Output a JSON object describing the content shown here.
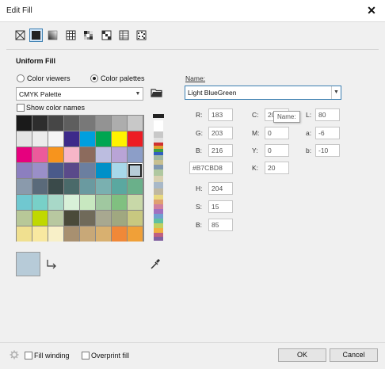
{
  "window": {
    "title": "Edit Fill",
    "close": "✕"
  },
  "fill_types": [
    {
      "name": "no-fill",
      "active": false
    },
    {
      "name": "uniform-fill",
      "active": true
    },
    {
      "name": "fountain-fill",
      "active": false
    },
    {
      "name": "vector-pattern",
      "active": false
    },
    {
      "name": "bitmap-pattern",
      "active": false
    },
    {
      "name": "two-color-pattern",
      "active": false
    },
    {
      "name": "texture-fill",
      "active": false
    }
  ],
  "uniform": {
    "heading": "Uniform Fill",
    "radio_viewers": "Color viewers",
    "radio_palettes": "Color palettes",
    "palette_value": "CMYK Palette",
    "show_names": "Show color names"
  },
  "palette_colors": [
    "#1a1a1a",
    "#2d2d2d",
    "#464646",
    "#5e5e5e",
    "#787878",
    "#939393",
    "#adadad",
    "#c8c8c8",
    "#e4e4e4",
    "#ececec",
    "#f5f5f5",
    "#3d2a8a",
    "#009fdf",
    "#00a651",
    "#fff200",
    "#ed1c24",
    "#e6007e",
    "#ec5a9b",
    "#f7941d",
    "#f7b6c8",
    "#8c6b5d",
    "#bcbde0",
    "#b9a4d6",
    "#8c9ec8",
    "#8c7fbf",
    "#9a8fc8",
    "#4a5a8a",
    "#5a4a8a",
    "#6b7fa0",
    "#0090c8",
    "#a8d8ea",
    "#b7cbd8",
    "#8a9aac",
    "#5a6a7a",
    "#3a4a4a",
    "#4a6a6a",
    "#6a9aa0",
    "#7ab0b0",
    "#5aa8a0",
    "#6ab08a",
    "#70c8d0",
    "#78d0c8",
    "#a8d8c8",
    "#d8f0d8",
    "#c8e8c0",
    "#a0c8a0",
    "#80c080",
    "#c8d8a8",
    "#b8c898",
    "#c0d800",
    "#b8c8a0",
    "#4a4a3a",
    "#706a5a",
    "#a8a890",
    "#a0a880",
    "#c8c880",
    "#f0e090",
    "#f8e8a0",
    "#f8f0c8",
    "#a89070",
    "#c8a878",
    "#d8b070",
    "#f08838",
    "#f0a038"
  ],
  "selected_index": 31,
  "selected_color": "#B7CBD8",
  "name": {
    "label": "Name:",
    "value": "Light BlueGreen"
  },
  "tooltip": "Name:",
  "values": {
    "R": "183",
    "G": "203",
    "B": "216",
    "C": "20",
    "M": "0",
    "Y": "0",
    "K": "20",
    "L": "80",
    "a": "-6",
    "b": "-10",
    "hex": "#B7CBD8",
    "H": "204",
    "S": "15",
    "Bv": "85"
  },
  "labels": {
    "R": "R:",
    "G": "G:",
    "B": "B:",
    "C": "C:",
    "M": "M:",
    "Y": "Y:",
    "K": "K:",
    "L": "L:",
    "a": "a:",
    "b": "b:",
    "H": "H:",
    "S": "S:",
    "Bv": "B:"
  },
  "bottom": {
    "fill_winding": "Fill winding",
    "overprint": "Overprint fill",
    "ok": "OK",
    "cancel": "Cancel"
  }
}
